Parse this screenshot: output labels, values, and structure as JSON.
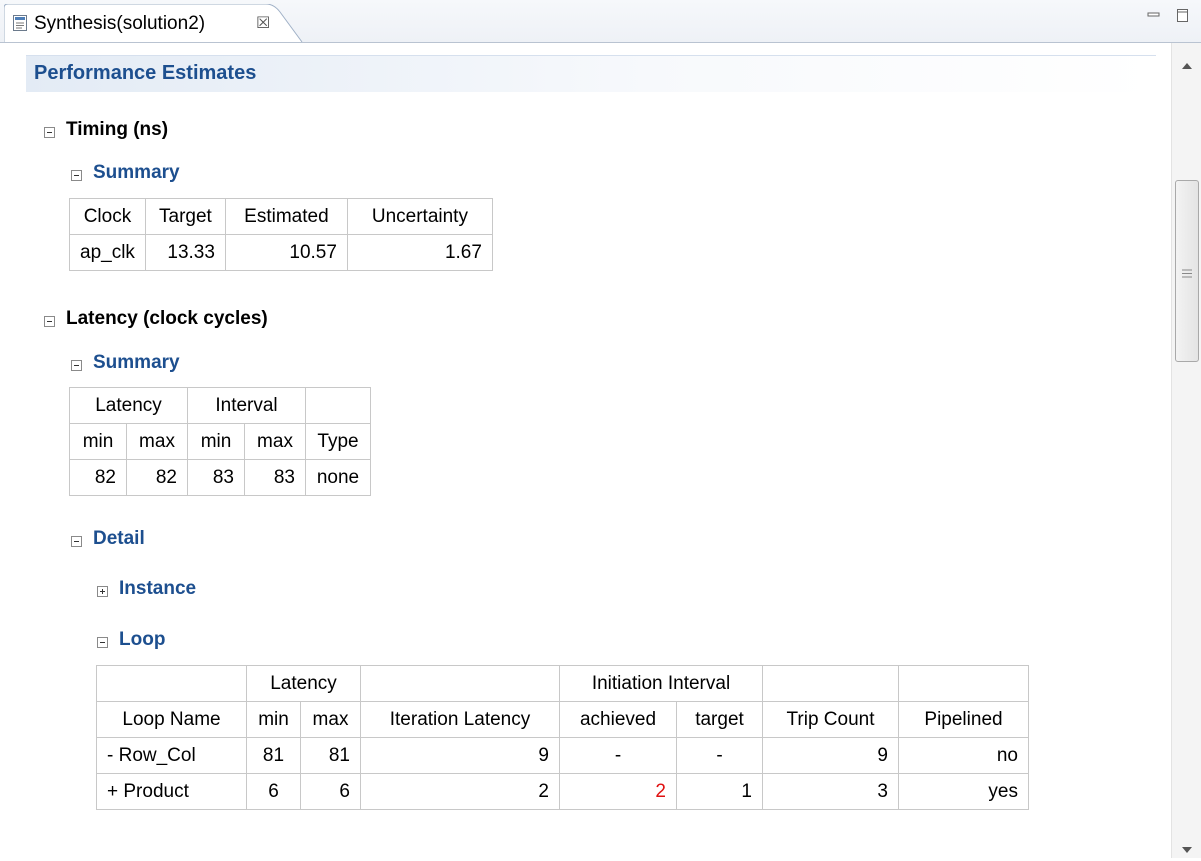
{
  "tab": {
    "title": "Synthesis(solution2)",
    "close_glyph": "☒"
  },
  "page": {
    "section_title": "Performance Estimates"
  },
  "timing": {
    "heading": "Timing (ns)",
    "summary": {
      "heading": "Summary",
      "headers": [
        "Clock",
        "Target",
        "Estimated",
        "Uncertainty"
      ],
      "row": [
        "ap_clk",
        "13.33",
        "10.57",
        "1.67"
      ]
    }
  },
  "latency": {
    "heading": "Latency (clock cycles)",
    "summary": {
      "heading": "Summary",
      "group_headers": [
        "Latency",
        "Interval",
        ""
      ],
      "headers": [
        "min",
        "max",
        "min",
        "max",
        "Type"
      ],
      "row": [
        "82",
        "82",
        "83",
        "83",
        "none"
      ]
    },
    "detail": {
      "heading": "Detail",
      "instance_heading": "Instance",
      "loop": {
        "heading": "Loop",
        "group_headers": [
          "",
          "Latency",
          "",
          "Initiation Interval",
          "",
          ""
        ],
        "headers": [
          "Loop Name",
          "min",
          "max",
          "Iteration Latency",
          "achieved",
          "target",
          "Trip Count",
          "Pipelined"
        ],
        "rows": [
          [
            "- Row_Col",
            "81",
            "81",
            "9",
            "-",
            "-",
            "9",
            "no"
          ],
          [
            "+ Product",
            "6",
            "6",
            "2",
            "2",
            "1",
            "3",
            "yes"
          ]
        ]
      }
    }
  },
  "colors": {
    "heading_blue": "#1d4f8f",
    "violation_red": "#e01010"
  }
}
